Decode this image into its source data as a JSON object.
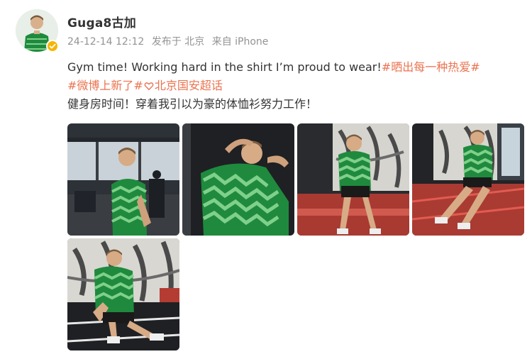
{
  "post": {
    "username": "Guga8古加",
    "timestamp": "24-12-14 12:12",
    "location": "发布于 北京",
    "source": "来自 iPhone",
    "text_en": "Gym time! Working hard in the shirt I’m proud to wear!",
    "hashtag_1": "#晒出每一种热爱#",
    "hashtag_2_start": "#微博上新了#",
    "hashtag_3_icon": "heart-icon",
    "hashtag_3": "北京国安超话",
    "text_cn": "健身房时间！穿着我引以为豪的体恤衫努力工作！",
    "photo_count": 5
  },
  "colors": {
    "hashtag": "#eb7350",
    "meta": "#939393",
    "jersey_green": "#1f8a3d",
    "verified": "#f7b500"
  }
}
